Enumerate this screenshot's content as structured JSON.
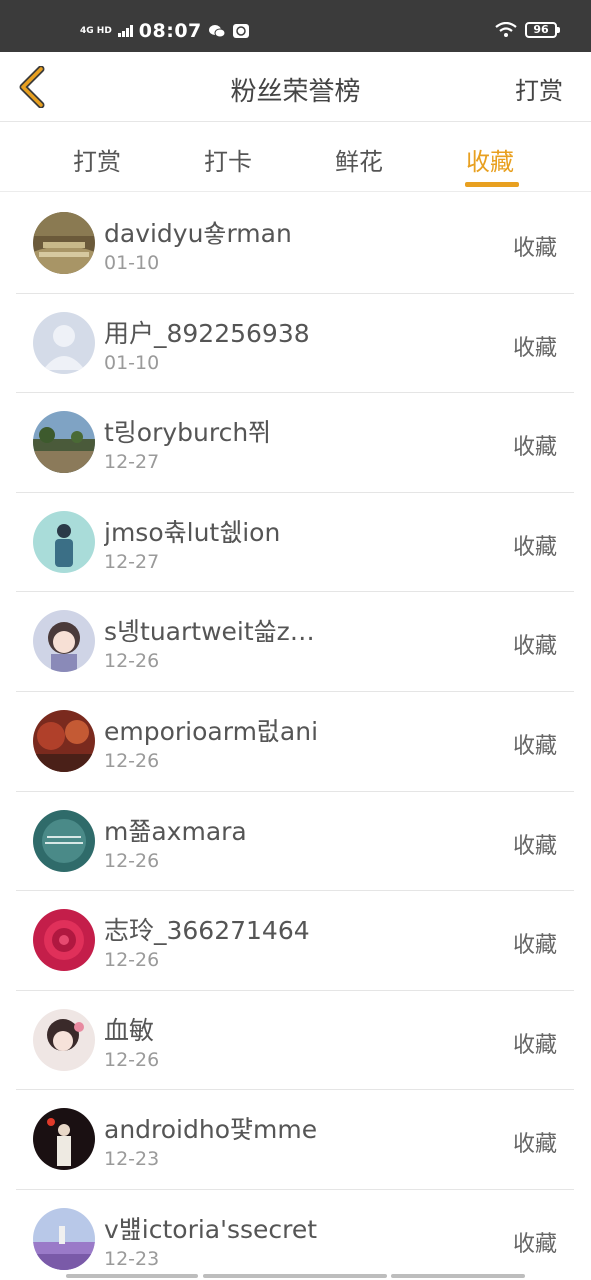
{
  "status_bar": {
    "network": "4G HD",
    "time": "08:07",
    "battery": "96"
  },
  "header": {
    "title": "粉丝荣誉榜",
    "action": "打赏"
  },
  "tabs": [
    {
      "label": "打赏"
    },
    {
      "label": "打卡"
    },
    {
      "label": "鲜花"
    },
    {
      "label": "收藏"
    }
  ],
  "active_tab": "收藏",
  "colors": {
    "accent": "#e8a020",
    "back_icon": "#e8a020",
    "status_bar": "#3b3b3b"
  },
  "rows": [
    {
      "name": "davidyu숗rman",
      "date": "01-10",
      "action": "收藏"
    },
    {
      "name": "用户_892256938",
      "date": "01-10",
      "action": "收藏"
    },
    {
      "name": "t링oryburch쮜",
      "date": "12-27",
      "action": "收藏"
    },
    {
      "name": "jmso츆lut쉢ion",
      "date": "12-27",
      "action": "收藏"
    },
    {
      "name": "s녱tuartweit쓻z…",
      "date": "12-26",
      "action": "收藏"
    },
    {
      "name": "emporioarm럾ani",
      "date": "12-26",
      "action": "收藏"
    },
    {
      "name": "m쬶axmara",
      "date": "12-26",
      "action": "收藏"
    },
    {
      "name": "志玲_366271464",
      "date": "12-26",
      "action": "收藏"
    },
    {
      "name": "血敏",
      "date": "12-26",
      "action": "收藏"
    },
    {
      "name": "androidho퍛mme",
      "date": "12-23",
      "action": "收藏"
    },
    {
      "name": "v뱶ictoria'ssecret",
      "date": "12-23",
      "action": "收藏"
    }
  ]
}
